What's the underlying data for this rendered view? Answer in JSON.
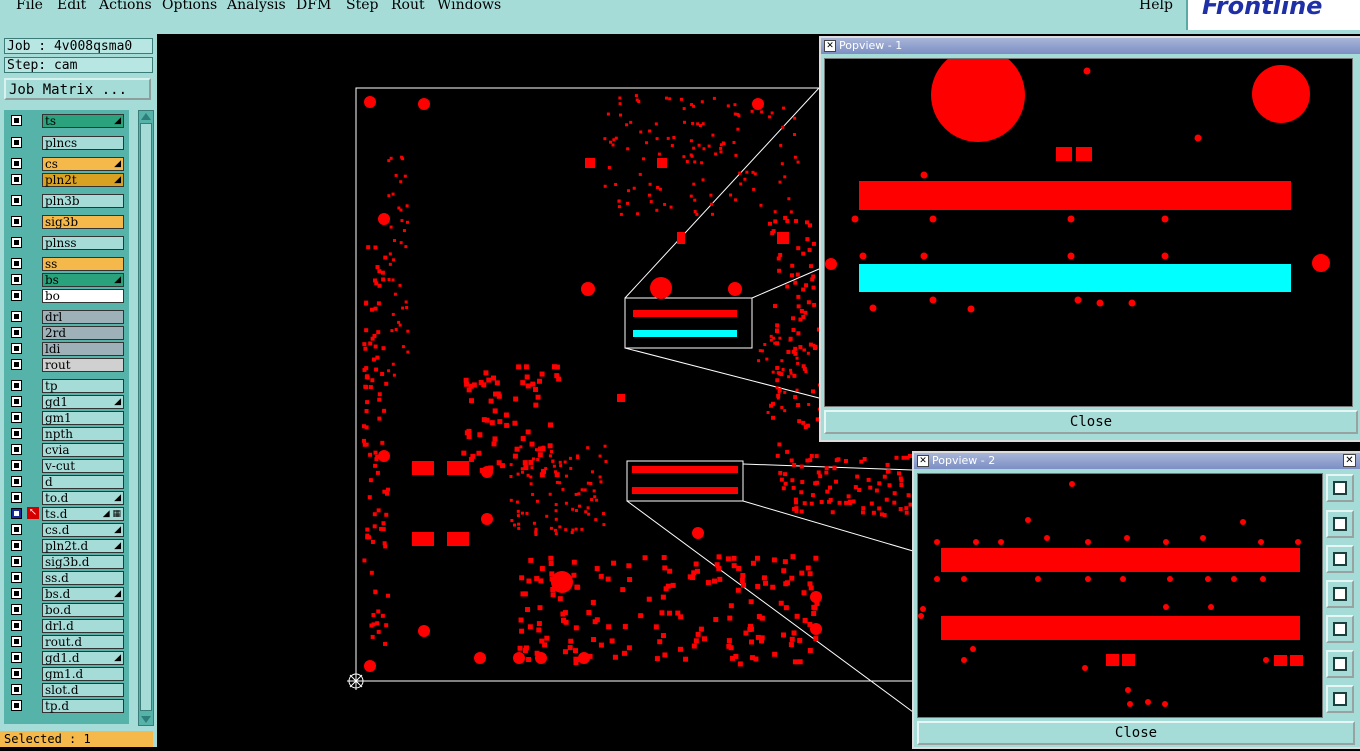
{
  "menu": {
    "items": [
      "File",
      "Edit",
      "Actions",
      "Options",
      "Analysis",
      "DFM",
      "Step",
      "Rout",
      "Windows"
    ],
    "help": "Help",
    "logo": "Frontline"
  },
  "job": {
    "label": "Job : 4v008qsma0",
    "step": "Step: cam",
    "matrix_button": "Job Matrix ..."
  },
  "layers": [
    {
      "name": "ts",
      "color": "#2aa37c",
      "mark": "◢"
    },
    {
      "name": "plncs",
      "color": "#a5dcd8",
      "mark": ""
    },
    {
      "name": "cs",
      "color": "#f5b84a",
      "mark": "◢"
    },
    {
      "name": "pln2t",
      "color": "#d8a122",
      "mark": "◢"
    },
    {
      "name": "pln3b",
      "color": "#a5dcd8",
      "mark": ""
    },
    {
      "name": "sig3b",
      "color": "#f5b84a",
      "mark": ""
    },
    {
      "name": "plnss",
      "color": "#a5dcd8",
      "mark": ""
    },
    {
      "name": "ss",
      "color": "#f5b84a",
      "mark": ""
    },
    {
      "name": "bs",
      "color": "#2aa37c",
      "mark": "◢"
    },
    {
      "name": "bo",
      "color": "#ffffff",
      "mark": ""
    },
    {
      "name": "drl",
      "color": "#9fb1b8",
      "mark": ""
    },
    {
      "name": "2rd",
      "color": "#9fb1b8",
      "mark": ""
    },
    {
      "name": "ldi",
      "color": "#9fb1b8",
      "mark": ""
    },
    {
      "name": "rout",
      "color": "#d0d0d0",
      "mark": ""
    },
    {
      "name": "tp",
      "color": "#a5dcd8",
      "mark": ""
    },
    {
      "name": "gd1",
      "color": "#a5dcd8",
      "mark": "◢"
    },
    {
      "name": "gm1",
      "color": "#a5dcd8",
      "mark": ""
    },
    {
      "name": "npth",
      "color": "#a5dcd8",
      "mark": ""
    },
    {
      "name": "cvia",
      "color": "#a5dcd8",
      "mark": ""
    },
    {
      "name": "v-cut",
      "color": "#a5dcd8",
      "mark": ""
    },
    {
      "name": "d",
      "color": "#a5dcd8",
      "mark": ""
    },
    {
      "name": "to.d",
      "color": "#a5dcd8",
      "mark": "◢"
    },
    {
      "name": "ts.d",
      "color": "#a5dcd8",
      "mark": "◢ ▦",
      "selected": true
    },
    {
      "name": "cs.d",
      "color": "#a5dcd8",
      "mark": "◢"
    },
    {
      "name": "pln2t.d",
      "color": "#a5dcd8",
      "mark": "◢"
    },
    {
      "name": "sig3b.d",
      "color": "#a5dcd8",
      "mark": ""
    },
    {
      "name": "ss.d",
      "color": "#a5dcd8",
      "mark": ""
    },
    {
      "name": "bs.d",
      "color": "#a5dcd8",
      "mark": "◢"
    },
    {
      "name": "bo.d",
      "color": "#a5dcd8",
      "mark": ""
    },
    {
      "name": "drl.d",
      "color": "#a5dcd8",
      "mark": ""
    },
    {
      "name": "rout.d",
      "color": "#a5dcd8",
      "mark": ""
    },
    {
      "name": "gd1.d",
      "color": "#a5dcd8",
      "mark": "◢"
    },
    {
      "name": "gm1.d",
      "color": "#a5dcd8",
      "mark": ""
    },
    {
      "name": "slot.d",
      "color": "#a5dcd8",
      "mark": ""
    },
    {
      "name": "tp.d",
      "color": "#a5dcd8",
      "mark": ""
    }
  ],
  "status": "Selected : 1",
  "popview1": {
    "title": "Popview - 1",
    "close": "Close"
  },
  "popview2": {
    "title": "Popview - 2",
    "close": "Close"
  },
  "colors": {
    "copper": "#ff0000",
    "highlight": "#00ffff",
    "panel": "#a5dcd8",
    "outline": "#ffffff"
  }
}
